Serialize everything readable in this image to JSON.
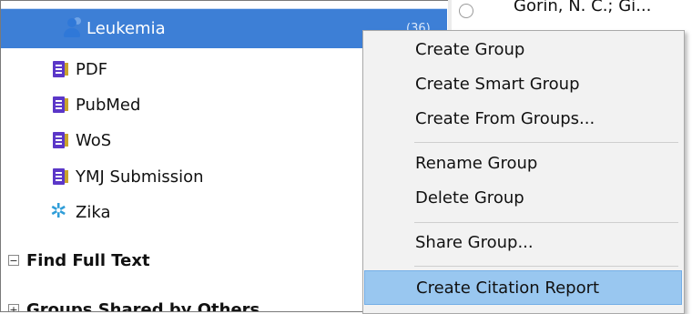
{
  "sidebar": {
    "selected": {
      "label": "Leukemia",
      "count": "(36)"
    },
    "groups": [
      {
        "label": "PDF"
      },
      {
        "label": "PubMed"
      },
      {
        "label": "WoS"
      },
      {
        "label": "YMJ Submission"
      }
    ],
    "smart_group": {
      "label": "Zika"
    },
    "find_full_text": {
      "label": "Find Full Text",
      "toggle": "−"
    },
    "groups_shared": {
      "label": "Groups Shared by Others",
      "toggle": "+"
    }
  },
  "reference_list": {
    "first_author": "Gorin, N. C.; Gi..."
  },
  "context_menu": {
    "items": [
      "Create Group",
      "Create Smart Group",
      "Create From Groups...",
      "Rename Group",
      "Delete Group",
      "Share Group...",
      "Create Citation Report"
    ],
    "highlighted": "Create Citation Report"
  },
  "colors": {
    "selection": "#3d7fd6",
    "menu_highlight": "#99c7f0",
    "group_icon": "#5b37c8",
    "smart_icon": "#2f9dd8"
  }
}
